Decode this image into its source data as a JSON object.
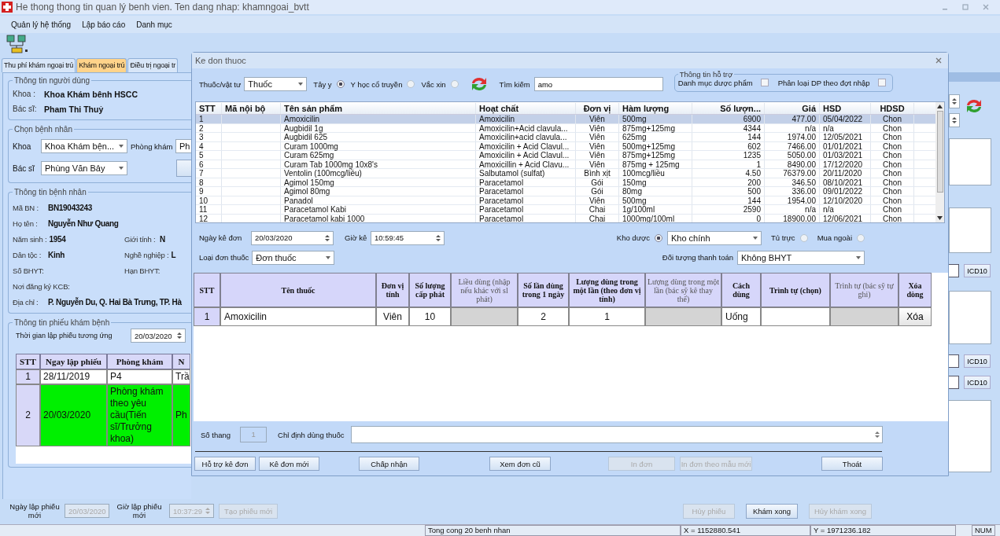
{
  "window": {
    "title": "He thong thong tin quan lý benh vien. Ten dang nhap: khamngoai_bvtt"
  },
  "menu": [
    "Quản lý hệ thống",
    "Lập báo cáo",
    "Danh mục"
  ],
  "tabs": [
    {
      "label": "Thu phí khám ngoại trú",
      "selected": false
    },
    {
      "label": "Khám ngoại trú",
      "selected": true
    },
    {
      "label": "Điều trị ngoại tr",
      "selected": false
    }
  ],
  "user_info": {
    "title": "Thông tin người dùng",
    "fields": [
      {
        "label": "Khoa :",
        "value": "Khoa Khám bênh  HSCC"
      },
      {
        "label": "Bác sĩ:",
        "value": "Pham Thi Thuỷ"
      }
    ]
  },
  "patient_select": {
    "title": "Chọn bệnh nhân",
    "department_label": "Khoa",
    "department_value": "Khoa Khám bện...",
    "clinic_label": "Phòng khám",
    "clinic_value": "Ph",
    "doctor_label": "Bác sĩ",
    "doctor_value": "Phùng Văn Bảy"
  },
  "patient_info": {
    "title": "Thông tin bệnh nhân",
    "rows": [
      [
        {
          "label": "Mã BN :",
          "value": "BN19043243"
        }
      ],
      [
        {
          "label": "Họ tên :",
          "value": "Nguyễn Như Quang"
        }
      ],
      [
        {
          "label": "Năm sinh :",
          "value": "1954"
        },
        {
          "label": "Giới tính :",
          "value": "N"
        }
      ],
      [
        {
          "label": "Dân tộc :",
          "value": "Kinh"
        },
        {
          "label": "Nghề nghiệp :",
          "value": "L"
        }
      ],
      [
        {
          "label": "Số BHYT:"
        },
        {
          "label": "Hạn BHYT:"
        }
      ],
      [
        {
          "label": "Nơi đăng ký KCB:"
        }
      ],
      [
        {
          "label": "Địa chỉ :",
          "value": "P. Nguyễn Du, Q. Hai Bà Trưng, TP. Hà"
        }
      ]
    ]
  },
  "visit_info": {
    "title": "Thông tin phiếu khám bệnh",
    "time_label": "Thời gian lập phiếu tương ứng",
    "time_value": "20/03/2020",
    "columns": [
      "STT",
      "Ngay lập phiếu",
      "Phòng khám",
      "N"
    ],
    "rows": [
      {
        "cells": [
          "1",
          "28/11/2019",
          "P4",
          "Trầ"
        ],
        "selected": false
      },
      {
        "cells": [
          "2",
          "20/03/2020",
          "Phòng khám theo yêu cầu(Tiến sĩ/Trưởng khoa)",
          "Ph"
        ],
        "selected": true
      }
    ]
  },
  "footer_left": {
    "date_label": "Ngày lập phiếu mới",
    "date_value": "20/03/2020",
    "time_label": "Giờ lập phiếu mới",
    "time_value": "10:37:29",
    "button": {
      "label": "Tạo phiếu mới",
      "disabled": true
    }
  },
  "footer_right": [
    {
      "label": "Hủy phiếu",
      "disabled": true
    },
    {
      "label": "Khám xong",
      "disabled": false
    },
    {
      "label": "Hủy khám xong",
      "disabled": true
    }
  ],
  "side_buttons": [
    "ICD10",
    "ICD10",
    "ICD10"
  ],
  "status_bar": [
    "Tong cong 20 benh nhan",
    "X = 1152880.541",
    "Y = 1971236.182",
    "NUM"
  ],
  "dialog": {
    "title": "Ke don thuoc",
    "type_label": "Thuốc/vật tư",
    "type_value": "Thuốc",
    "medicine_types": [
      {
        "label": "Tây y",
        "selected": true
      },
      {
        "label": "Y học cổ truyền",
        "selected": false
      },
      {
        "label": "Vắc xin",
        "selected": false
      }
    ],
    "search_label": "Tìm kiếm",
    "search_value": "amo",
    "support": {
      "title": "Thông tin hỗ trợ",
      "options": [
        {
          "label": "Danh mục dược phẩm",
          "checked": false
        },
        {
          "label": "Phân loại DP theo đợt nhập",
          "checked": false
        }
      ]
    },
    "products": {
      "columns": [
        "STT",
        "Mã nội bộ",
        "Tên sản phẩm",
        "Hoạt chất",
        "Đơn vị",
        "Hàm lượng",
        "Số lượn...",
        "Giá",
        "HSD",
        "HDSD"
      ],
      "rows": [
        {
          "cells": [
            "1",
            "",
            "Amoxicilin",
            "Amoxicilin",
            "Viên",
            "500mg",
            "6900",
            "477.00",
            "05/04/2022",
            "Chon"
          ],
          "selected": true
        },
        {
          "cells": [
            "2",
            "",
            "Augbidil 1g",
            "Amoxicilin+Acid clavula...",
            "Viên",
            "875mg+125mg",
            "4344",
            "n/a",
            "n/a",
            "Chon"
          ],
          "selected": false
        },
        {
          "cells": [
            "3",
            "",
            "Augbidil 625",
            "Amoxicilin+acid clavula...",
            "Viên",
            "625mg",
            "144",
            "1974.00",
            "12/05/2021",
            "Chon"
          ],
          "selected": false
        },
        {
          "cells": [
            "4",
            "",
            "Curam 1000mg",
            "Amoxicilin + Acid Clavul...",
            "Viên",
            "500mg+125mg",
            "602",
            "7466.00",
            "01/01/2021",
            "Chon"
          ],
          "selected": false
        },
        {
          "cells": [
            "5",
            "",
            "Curam 625mg",
            "Amoxicilin + Acid Clavul...",
            "Viên",
            "875mg+125mg",
            "1235",
            "5050.00",
            "01/03/2021",
            "Chon"
          ],
          "selected": false
        },
        {
          "cells": [
            "6",
            "",
            "Curam Tab 1000mg 10x8's",
            "Amoxicillin + Acid Clavu...",
            "Viên",
            "875mg + 125mg",
            "1",
            "8490.00",
            "17/12/2020",
            "Chon"
          ],
          "selected": false
        },
        {
          "cells": [
            "7",
            "",
            "Ventolin (100mcg/liều)",
            "Salbutamol (sulfat)",
            "Bình xịt",
            "100mcg/liều",
            "4.50",
            "76379.00",
            "20/11/2020",
            "Chon"
          ],
          "selected": false
        },
        {
          "cells": [
            "8",
            "",
            "Agimol 150mg",
            "Paracetamol",
            "Gói",
            "150mg",
            "200",
            "346.50",
            "08/10/2021",
            "Chon"
          ],
          "selected": false
        },
        {
          "cells": [
            "9",
            "",
            "Agimol 80mg",
            "Paracetamol",
            "Gói",
            "80mg",
            "500",
            "336.00",
            "09/01/2022",
            "Chon"
          ],
          "selected": false
        },
        {
          "cells": [
            "10",
            "",
            "Panadol",
            "Paracetamol",
            "Viên",
            "500mg",
            "144",
            "1954.00",
            "12/10/2020",
            "Chon"
          ],
          "selected": false
        },
        {
          "cells": [
            "11",
            "",
            "Paracetamol Kabi",
            "Paracetamol",
            "Chai",
            "1g/100ml",
            "2590",
            "n/a",
            "n/a",
            "Chon"
          ],
          "selected": false
        },
        {
          "cells": [
            "12",
            "",
            "Paracetamol kabi 1000",
            "Paracetamol",
            "Chai",
            "1000mg/100ml",
            "0",
            "18900.00",
            "12/06/2021",
            "Chon"
          ],
          "selected": false
        }
      ]
    },
    "date_label": "Ngày kê đơn",
    "date_value": "20/03/2020",
    "time_label": "Giờ kê",
    "time_value": "10:59:45",
    "sources": [
      {
        "label": "Kho dược",
        "selected": true
      },
      {
        "label": "Tủ trực",
        "selected": false
      },
      {
        "label": "Mua ngoài",
        "selected": false
      }
    ],
    "warehouse": "Kho chính",
    "rx_type_label": "Loại đơn thuốc",
    "rx_type_value": "Đơn thuốc",
    "payer_label": "Đối tượng thanh toán",
    "payer_value": "Không BHYT",
    "rx": {
      "columns": [
        {
          "label": "STT",
          "editable": true
        },
        {
          "label": "Tên thuốc",
          "editable": true
        },
        {
          "label": "Đơn vị tính",
          "editable": true
        },
        {
          "label": "Số lượng cấp phát",
          "editable": true
        },
        {
          "label": "Liều dùng (nhập nếu khác với sl phát)",
          "editable": false
        },
        {
          "label": "Số lần dùng trong 1 ngày",
          "editable": true
        },
        {
          "label": "Lượng dùng trong một lần (theo đơn vị tính)",
          "editable": true
        },
        {
          "label": "Lượng dùng trong một lần (bác sỹ kê thay thế)",
          "editable": false
        },
        {
          "label": "Cách dùng",
          "editable": true
        },
        {
          "label": "Trình tự (chọn)",
          "editable": true
        },
        {
          "label": "Trình tự (bác sỹ tự ghi)",
          "editable": false
        },
        {
          "label": "Xóa dòng",
          "editable": true
        }
      ],
      "rows": [
        {
          "cells": [
            "1",
            "Amoxicilin",
            "Viên",
            "10",
            null,
            "2",
            "1",
            null,
            "Uống",
            null,
            null,
            "Xóa"
          ]
        }
      ]
    },
    "dose_count_label": "Số thang",
    "dose_count_value": "1",
    "instructions_label": "Chỉ định dùng thuốc",
    "buttons": [
      {
        "label": "Hỗ trợ kê đơn",
        "disabled": false
      },
      {
        "label": "Kê đơn mới",
        "disabled": false
      },
      {
        "label": "Chấp nhận",
        "disabled": false
      },
      {
        "label": "Xem đơn cũ",
        "disabled": false
      },
      {
        "label": "In đơn",
        "disabled": true
      },
      {
        "label": "In đơn theo mẫu mới",
        "disabled": true
      },
      {
        "label": "Thoát",
        "disabled": false
      }
    ]
  }
}
